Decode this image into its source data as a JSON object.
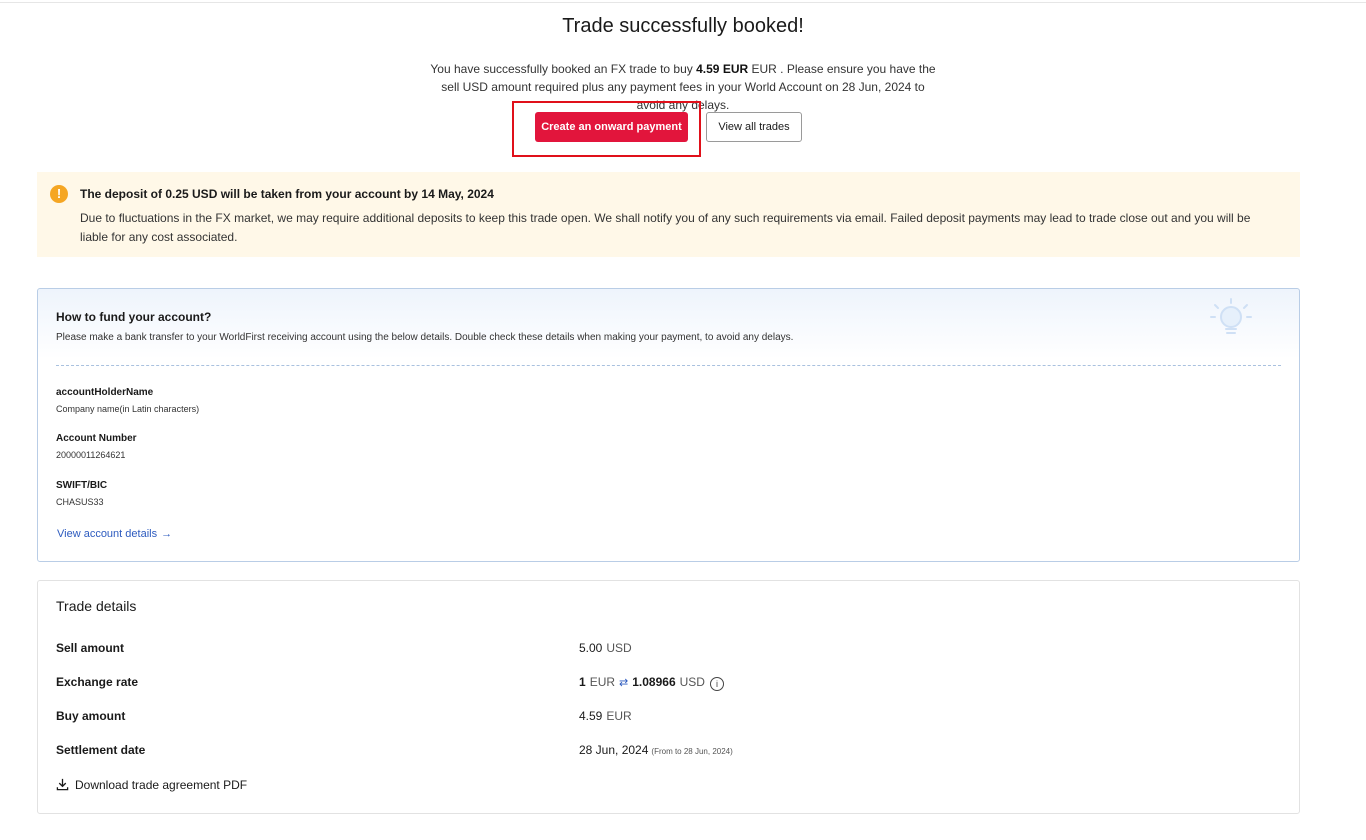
{
  "hero": {
    "title": "Trade successfully booked!",
    "msg_part1": "You have successfully booked an FX trade to buy ",
    "msg_bold": "4.59 EUR",
    "msg_part2": " EUR . Please ensure you have the sell USD amount required plus any payment fees in your World Account on 28 Jun, 2024 to avoid any delays.",
    "primary_button": "Create an onward payment",
    "secondary_button": "View all trades",
    "highlight_color": "#e0101a",
    "primary_color": "#e2153c"
  },
  "notice": {
    "icon": "exclamation-icon",
    "icon_glyph": "!",
    "title": "The deposit of 0.25 USD will be taken from your account by 14 May, 2024",
    "body": "Due to fluctuations in the FX market, we may require additional deposits to keep this trade open. We shall notify you of any such requirements via email. Failed deposit payments may lead to trade close out and you will be liable for any cost associated.",
    "icon_color": "#f5a623",
    "background": "#fff8e8"
  },
  "fund": {
    "title": "How to fund your account?",
    "description": "Please make a bank transfer to your WorldFirst receiving account using the below details. Double check these details when making your payment, to avoid any delays.",
    "icon": "lightbulb-icon",
    "fields": [
      {
        "label": "accountHolderName",
        "value": "Company name(in Latin characters)"
      },
      {
        "label": "Account Number",
        "value": "20000011264621"
      },
      {
        "label": "SWIFT/BIC",
        "value": "CHASUS33"
      }
    ],
    "link_label": "View account details",
    "link_arrow": "→",
    "link_color": "#2d5bbf"
  },
  "trade": {
    "title": "Trade details",
    "sell": {
      "label": "Sell amount",
      "amount": "5.00",
      "currency": "USD"
    },
    "rate": {
      "label": "Exchange rate",
      "base_amount": "1",
      "base_currency": "EUR",
      "swap_icon": "⇄",
      "rate_value": "1.08966",
      "quote_currency": "USD",
      "info_glyph": "i"
    },
    "buy": {
      "label": "Buy amount",
      "amount": "4.59",
      "currency": "EUR"
    },
    "settlement": {
      "label": "Settlement date",
      "date": "28 Jun, 2024",
      "note": "(From to 28 Jun, 2024)"
    },
    "download_label": "Download trade agreement PDF",
    "download_icon": "download-icon"
  }
}
